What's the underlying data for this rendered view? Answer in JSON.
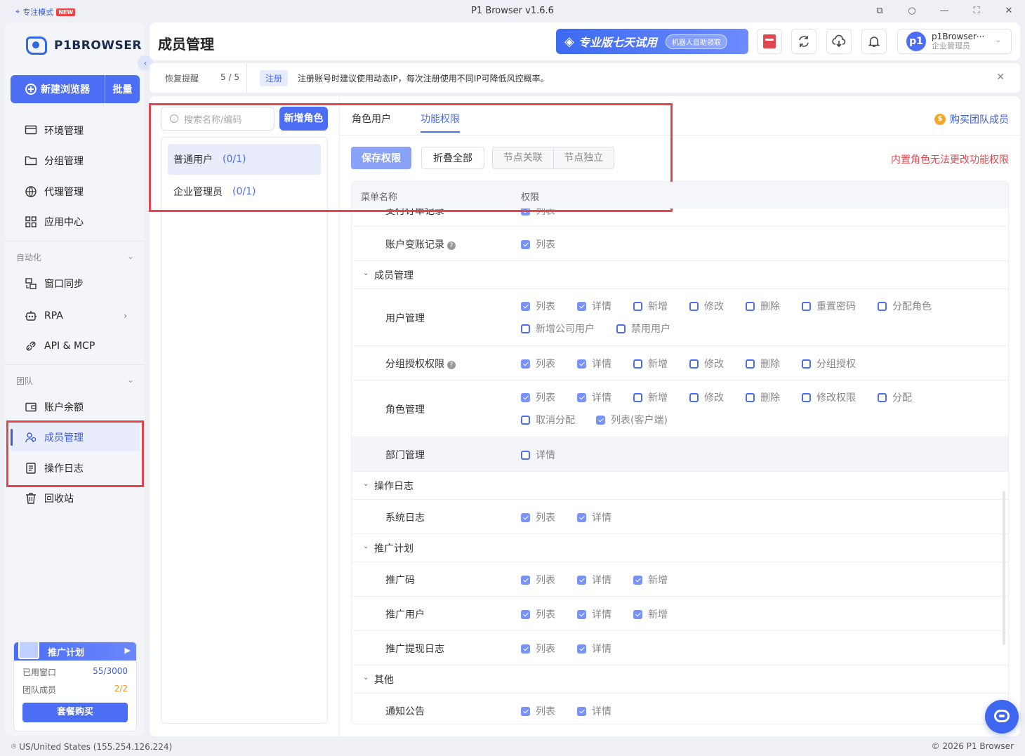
{
  "titlebar": {
    "focus_mode": "专注模式",
    "new_badge": "NEW",
    "app_title": "P1 Browser v1.6.6"
  },
  "sidebar": {
    "logo_text": "P1BROWSER",
    "new_browser": "新建浏览器",
    "batch": "批量",
    "items": [
      {
        "label": "环境管理",
        "icon": "monitor-icon"
      },
      {
        "label": "分组管理",
        "icon": "folder-icon"
      },
      {
        "label": "代理管理",
        "icon": "globe-icon"
      },
      {
        "label": "应用中心",
        "icon": "grid-icon"
      }
    ],
    "automation_label": "自动化",
    "automation_items": [
      {
        "label": "窗口同步",
        "icon": "window-sync-icon"
      },
      {
        "label": "RPA",
        "icon": "robot-icon"
      },
      {
        "label": "API & MCP",
        "icon": "plug-icon"
      }
    ],
    "team_label": "团队",
    "team_items": [
      {
        "label": "账户余额",
        "icon": "wallet-icon"
      },
      {
        "label": "成员管理",
        "icon": "users-icon"
      },
      {
        "label": "操作日志",
        "icon": "log-icon"
      },
      {
        "label": "回收站",
        "icon": "trash-icon"
      }
    ],
    "promo": {
      "title": "推广计划",
      "used_windows_label": "已用窗口",
      "used_windows_value": "55/3000",
      "team_members_label": "团队成员",
      "team_members_value": "2/2",
      "buy_label": "套餐购买"
    }
  },
  "header": {
    "title": "成员管理",
    "trial_text": "专业版七天试用",
    "trial_pill": "机器人自助领取",
    "user_name": "p1Browser···",
    "user_role": "企业管理员",
    "avatar_text": "p1"
  },
  "notice": {
    "restore_label": "恢复提醒",
    "restore_count": "5 / 5",
    "tag": "注册",
    "message": "注册账号时建议使用动态IP，每次注册使用不同IP可降低风控概率。"
  },
  "roles": {
    "search_placeholder": "搜索名称/编码",
    "add_role": "新增角色",
    "list": [
      {
        "name": "普通用户",
        "count": "(0/1)"
      },
      {
        "name": "企业管理员",
        "count": "(0/1)"
      }
    ]
  },
  "tabs": {
    "role_users": "角色用户",
    "permissions": "功能权限",
    "buy_team": "购买团队成员"
  },
  "toolbar": {
    "save": "保存权限",
    "fold_all": "折叠全部",
    "node_linked": "节点关联",
    "node_independent": "节点独立",
    "builtin_warning": "内置角色无法更改功能权限"
  },
  "table": {
    "col_menu": "菜单名称",
    "col_perm": "权限",
    "partial_row": "支付订单记录",
    "partial_perm": "列表",
    "rows": {
      "account_change": "账户变账记录",
      "group_member": "成员管理",
      "user_mgmt": "用户管理",
      "group_auth": "分组授权权限",
      "role_mgmt": "角色管理",
      "dept_mgmt": "部门管理",
      "group_oplog": "操作日志",
      "sys_log": "系统日志",
      "group_promo": "推广计划",
      "promo_code": "推广码",
      "promo_user": "推广用户",
      "promo_withdraw": "推广提现日志",
      "group_other": "其他",
      "notice": "通知公告"
    },
    "perms": {
      "list": "列表",
      "detail": "详情",
      "add": "新增",
      "edit": "修改",
      "delete": "删除",
      "reset_pwd": "重置密码",
      "assign_role": "分配角色",
      "add_company_user": "新增公司用户",
      "disable_user": "禁用用户",
      "group_grant": "分组授权",
      "edit_perm": "修改权限",
      "assign": "分配",
      "cancel_assign": "取消分配",
      "list_client": "列表(客户端)"
    }
  },
  "status": {
    "location": "US/United States (155.254.126.224)",
    "copyright": "© 2026 P1 Browser"
  }
}
